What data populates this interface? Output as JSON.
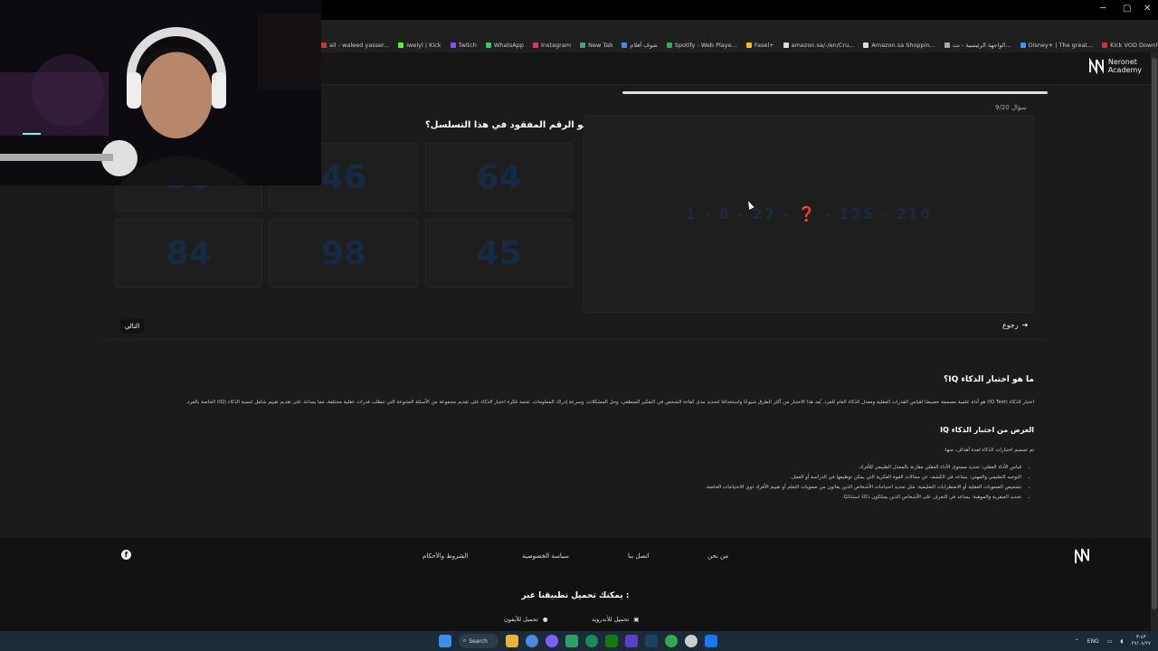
{
  "browser": {
    "bookmarks": [
      {
        "label": "ail - waleed yasser...",
        "icon": "mail-icon",
        "color": "#c33"
      },
      {
        "label": "iwelyl | Kick",
        "icon": "kick-icon",
        "color": "#53fc18"
      },
      {
        "label": "Twitch",
        "icon": "twitch-icon",
        "color": "#9146ff"
      },
      {
        "label": "WhatsApp",
        "icon": "whatsapp-icon",
        "color": "#25d366"
      },
      {
        "label": "Instagram",
        "icon": "instagram-icon",
        "color": "#e1306c"
      },
      {
        "label": "New Tab",
        "icon": "new-tab-icon",
        "color": "#3a8"
      },
      {
        "label": "شوف أفلام",
        "icon": "film-icon",
        "color": "#48f"
      },
      {
        "label": "Spotify - Web Playe...",
        "icon": "spotify-icon",
        "color": "#1db954"
      },
      {
        "label": "Fasel+",
        "icon": "fasel-icon",
        "color": "#fb0"
      },
      {
        "label": "amazon.sa/-/en/Cru...",
        "icon": "amazon-icon",
        "color": "#ddd"
      },
      {
        "label": "Amazon.sa Shoppin...",
        "icon": "amazon-icon",
        "color": "#ddd"
      },
      {
        "label": "الواجهة الرئيسية - نت...",
        "icon": "netflix-icon",
        "color": "#aaa"
      },
      {
        "label": "Disney+ | The great...",
        "icon": "disney-icon",
        "color": "#39f"
      },
      {
        "label": "Kick VOD Download...",
        "icon": "kick-icon",
        "color": "#c33"
      },
      {
        "label": "securema.ikea.com/...",
        "icon": "ikea-icon",
        "color": "#ddd"
      }
    ]
  },
  "site": {
    "logo_line1": "Neronet",
    "logo_line2": "Academy"
  },
  "quiz": {
    "counter": "سؤال 9/20",
    "question": "ما هو الرقم المفقود في هذا التسلسل؟",
    "sequence": [
      "1",
      "8",
      "27",
      "125",
      "216"
    ],
    "missing_mark": "❓",
    "options": [
      "36",
      "46",
      "64",
      "84",
      "98",
      "45"
    ],
    "next_label": "التالي",
    "back_label": "رجوع",
    "progress_fraction": 0.45
  },
  "article": {
    "title": "ما هو اختبار الذكاء IQ؟",
    "paragraph": "اختبار الذكاء (IQ Test) هو أداة علمية مصممة خصيصًا لقياس القدرات العقلية ومعدل الذكاء العام للفرد. يُعد هذا الاختبار من أكثر الطرق شيوعًا واستخدامًا لتحديد مدى كفاءة الشخص في التفكير المنطقي، وحل المشكلات، وسرعة إدراك المعلومات. تعتمد فكرة اختبار الذكاء على تقديم مجموعة من الأسئلة المتنوعة التي تتطلب قدرات عقلية مختلفة، مما يساعد على تقديم تقييم شامل لنسبة الذكاء (IQ) الخاصة بالفرد.",
    "subtitle": "الغرض من اختبار الذكاء IQ",
    "intro": "تم تصميم اختبارات الذكاء لعدة أهداف، منها:",
    "bullets": [
      "قياس الأداء العقلي: تحديد مستوى الأداء العقلي مقارنة بالمعدل الطبيعي للأفراد.",
      "التوجيه التعليمي والمهني: يساعد في الكشف عن مجالات القوة الفكرية التي يمكن توظيفها في الدراسة أو العمل.",
      "تشخيص الصعوبات العقلية أو الاضطرابات التعليمية: مثل تحديد احتياجات الأشخاص الذين يعانون من صعوبات التعلم أو تقييم الأفراد ذوي الاحتياجات الخاصة.",
      "تحديد العبقرية والموهبة: يساعد في التعرف على الأشخاص الذين يمتلكون ذكاءً استثنائيًا."
    ]
  },
  "footer": {
    "links": [
      "من نحن",
      "اتصل بنا",
      "سياسة الخصوصية",
      "الشروط والأحكام"
    ],
    "download_title": "يمكنك تحميل تطبيقنا عبر :",
    "android_label": "تحميل للأندرويد",
    "iphone_label": "تحميل للآيفون",
    "facebook_glyph": "f"
  },
  "taskbar": {
    "search_label": "Search",
    "lang": "ENG",
    "time": "٣:٤٣",
    "date": "٢٧/٠٨/٢٧"
  }
}
